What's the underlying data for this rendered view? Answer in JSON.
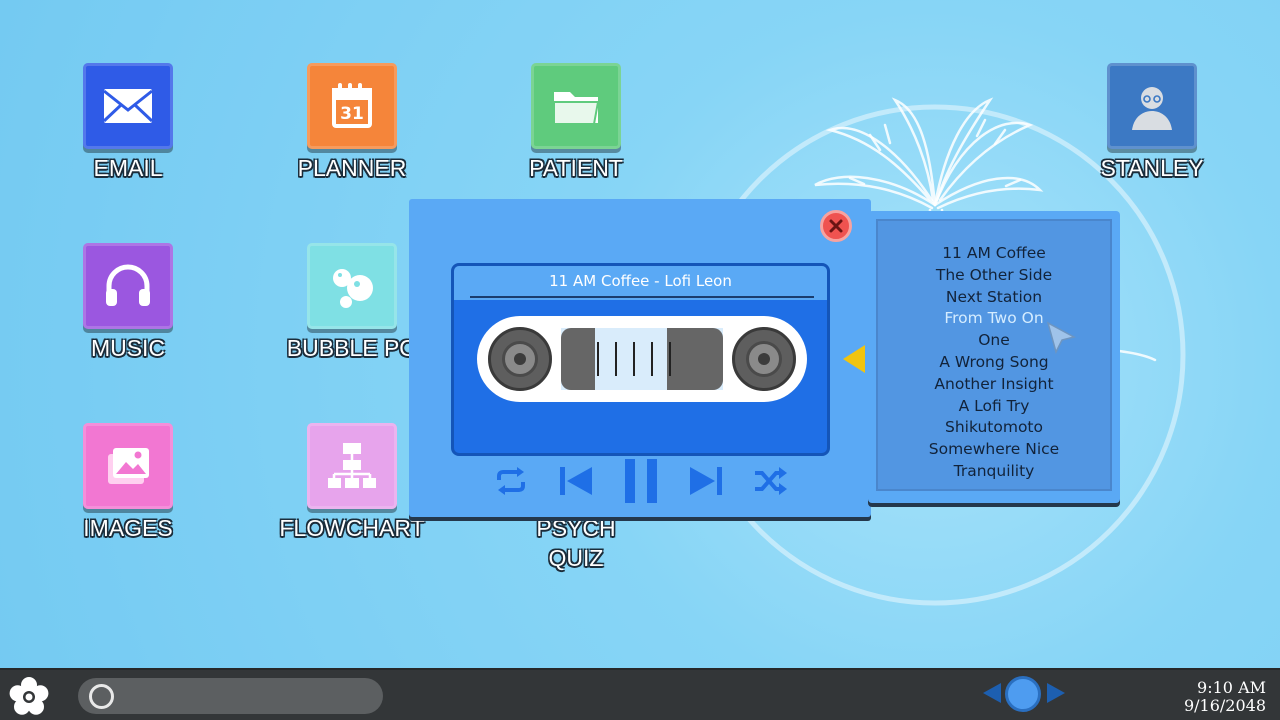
{
  "desktop": {
    "icons": [
      {
        "id": "email",
        "label": "EMAIL",
        "icon": "envelope-icon",
        "color": "#2f5be7"
      },
      {
        "id": "planner",
        "label": "PLANNER",
        "icon": "calendar-icon",
        "color": "#f5853a",
        "calendar_day": "31"
      },
      {
        "id": "patient",
        "label": "PATIENT",
        "icon": "folder-icon",
        "color": "#5fcb7d"
      },
      {
        "id": "stanley",
        "label": "STANLEY",
        "icon": "user-avatar-icon",
        "color": "#3c79c4"
      },
      {
        "id": "music",
        "label": "MUSIC",
        "icon": "headphones-icon",
        "color": "#9b57e0"
      },
      {
        "id": "bubble-pop",
        "label": "BUBBLE PO",
        "icon": "bubbles-icon",
        "color": "#7fe0e4"
      },
      {
        "id": "images",
        "label": "IMAGES",
        "icon": "images-icon",
        "color": "#f277d2"
      },
      {
        "id": "flowchart",
        "label": "FLOWCHART",
        "icon": "flowchart-icon",
        "color": "#e7a4ec"
      },
      {
        "id": "psych-quiz",
        "label_line1": "PSYCH",
        "label_line2": "QUIZ"
      }
    ]
  },
  "player": {
    "now_playing": "11 AM Coffee - Lofi Leon",
    "state": "playing",
    "colors": {
      "window": "#5aa9f5",
      "cassette": "#1f6fe6",
      "controls": "#1f6fe6",
      "close": "#ef5350"
    },
    "controls": [
      "repeat-icon",
      "skip-previous-icon",
      "pause-icon",
      "skip-next-icon",
      "shuffle-icon"
    ]
  },
  "playlist": {
    "tracks": [
      "11 AM Coffee",
      "The Other Side",
      "Next Station",
      "From Two On",
      "One",
      "A Wrong Song",
      "Another Insight",
      "A Lofi Try",
      "Shikutomoto",
      "Somewhere Nice",
      "Tranquility"
    ],
    "highlighted_index": 3
  },
  "taskbar": {
    "start_icon": "flower-icon",
    "search_icon": "search-circle-icon",
    "clock": {
      "time": "9:10 AM",
      "date": "9/16/2048"
    }
  }
}
